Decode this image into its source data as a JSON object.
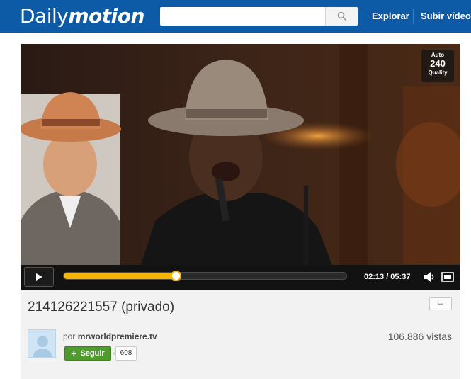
{
  "header": {
    "logo_regular": "Daily",
    "logo_bold": "motion",
    "search_placeholder": "",
    "nav": {
      "explore": "Explorar",
      "upload": "Subir vídeo"
    },
    "brand_color": "#0d5aa7"
  },
  "player": {
    "quality": {
      "auto": "Auto",
      "resolution": "240",
      "label": "Quality"
    },
    "time": {
      "current": "02:13",
      "total": "05:37",
      "display": "02:13 / 05:37"
    },
    "progress_fraction": 0.395,
    "accent_color": "#f7b500",
    "icons": [
      "play-icon",
      "volume-icon",
      "fullscreen-icon"
    ]
  },
  "video": {
    "title": "214126221557 (privado)",
    "expand_label": "↔",
    "by_prefix": "por",
    "user": "mrworldpremiere.tv",
    "views": "106.886 vistas",
    "follow_label": "Seguir",
    "follower_count": "608"
  }
}
